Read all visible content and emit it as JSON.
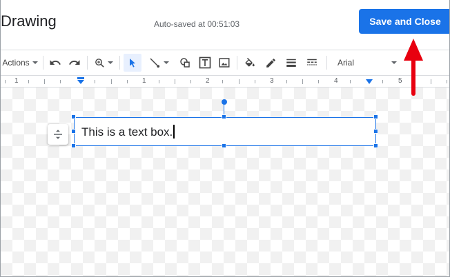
{
  "header": {
    "title": "Drawing",
    "autosave": "Auto-saved at 00:51:03",
    "save_label": "Save and Close"
  },
  "toolbar": {
    "actions_label": "Actions",
    "font_label": "Arial",
    "icons": [
      "undo-icon",
      "redo-icon",
      "zoom-icon",
      "select-icon",
      "line-icon",
      "shape-icon",
      "textbox-icon",
      "image-icon",
      "fill-color-icon",
      "border-color-icon",
      "border-weight-icon",
      "border-dash-icon"
    ],
    "selected_tool": "select-icon"
  },
  "ruler": {
    "numbers": [
      "1",
      "1",
      "2",
      "3",
      "4",
      "5"
    ]
  },
  "canvas": {
    "textbox_text": "This is a text box."
  },
  "colors": {
    "accent": "#1a73e8",
    "annotation_arrow": "#e8000f"
  }
}
